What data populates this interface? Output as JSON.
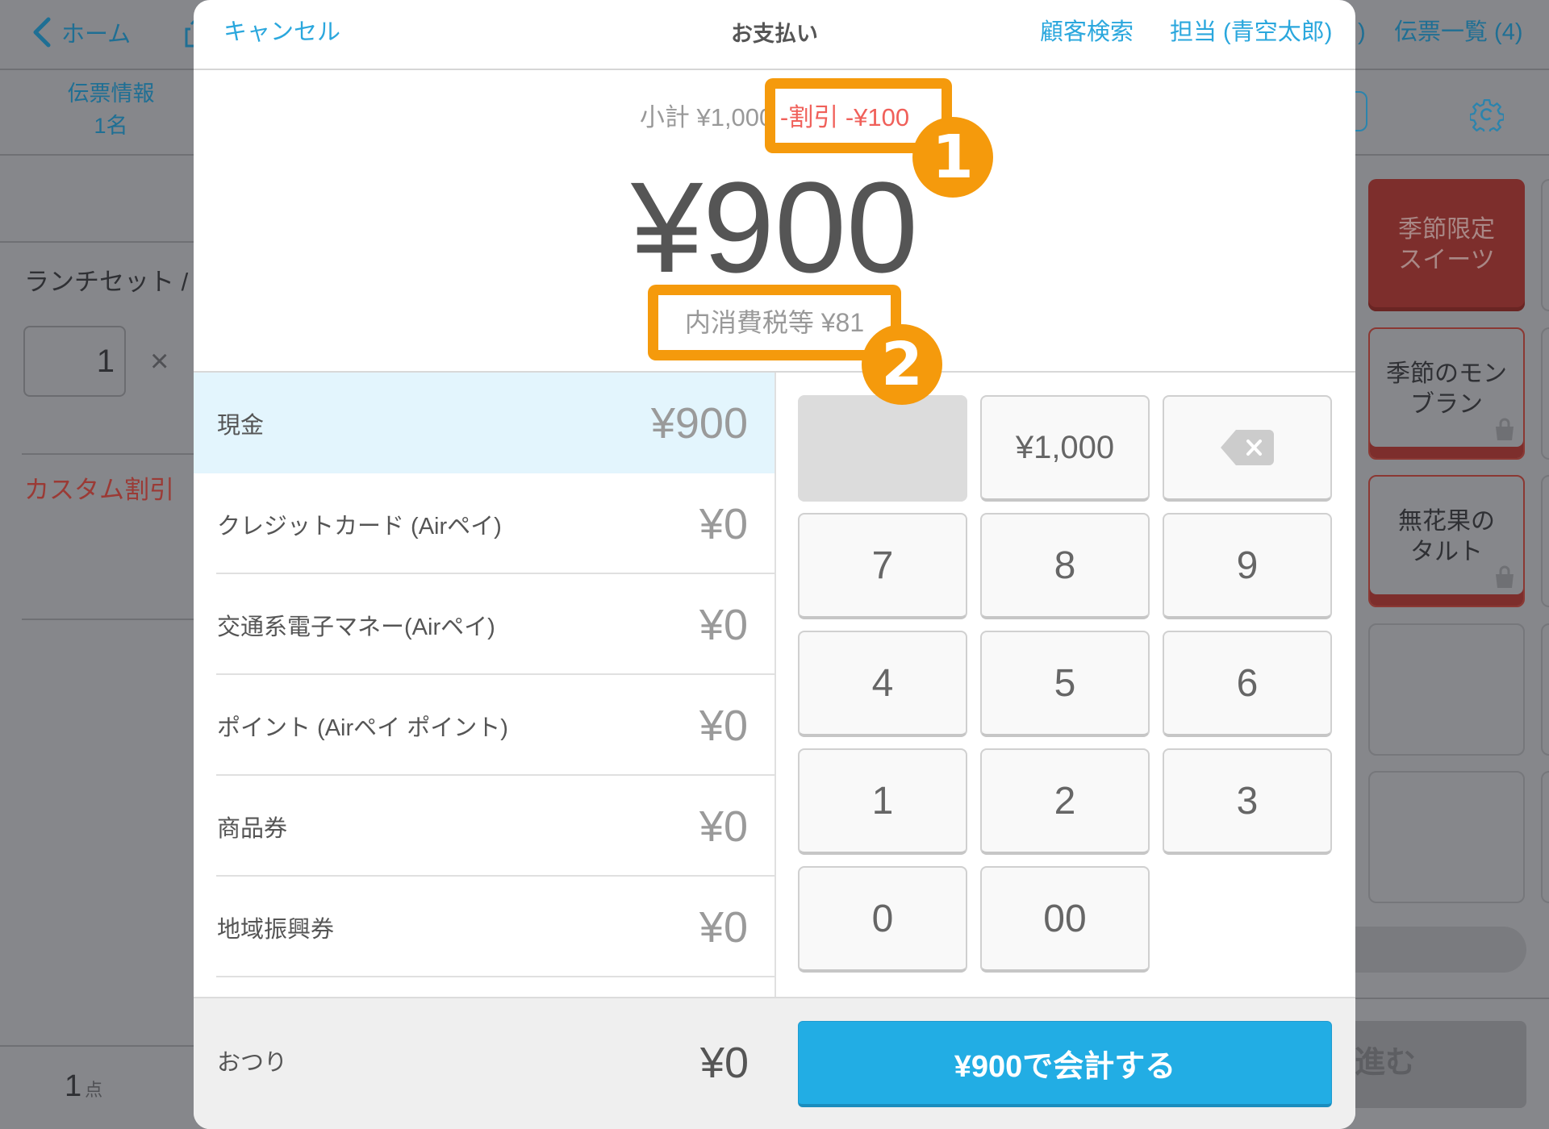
{
  "colors": {
    "accent": "#2aa7dd",
    "primary_button": "#22ade4",
    "discount_text": "#f0605a",
    "annotation": "#f59a0c",
    "selected_row": "#e3f5fd"
  },
  "icons": {
    "back": "chevron-left-icon",
    "share": "share-icon",
    "settings": "gear-icon",
    "bag": "shopping-bag-icon",
    "backspace": "backspace-icon"
  },
  "background": {
    "header": {
      "back_label": "ホーム",
      "partial_label": ")",
      "slip_list_label": "伝票一覧 (4)"
    },
    "slip_info": {
      "title": "伝票情報",
      "guests": "1名"
    },
    "order": {
      "item_name": "ランチセット /",
      "quantity": "1",
      "multiply": "×",
      "discount_label": "カスタム割引",
      "total_count": "1",
      "total_count_unit": "点"
    },
    "menu_tiles": [
      {
        "label": "季節限定\nスイーツ",
        "kind": "category"
      },
      {
        "label": "季節のモン\nブラン",
        "kind": "item"
      },
      {
        "label": "無花果の\nタルト",
        "kind": "item"
      }
    ],
    "proceed_label": "進む"
  },
  "modal": {
    "header": {
      "cancel": "キャンセル",
      "title": "お支払い",
      "customer_search": "顧客検索",
      "staff": "担当 (青空太郎)"
    },
    "summary": {
      "subtotal": "小計 ¥1,000",
      "discount": "-割引 -¥100",
      "total": "¥900",
      "tax": "内消費税等 ¥81"
    },
    "payment_methods": [
      {
        "label": "現金",
        "amount": "¥900",
        "selected": true
      },
      {
        "label": "クレジットカード (Airペイ)",
        "amount": "¥0",
        "selected": false
      },
      {
        "label": "交通系電子マネー(Airペイ)",
        "amount": "¥0",
        "selected": false
      },
      {
        "label": "ポイント (Airペイ ポイント)",
        "amount": "¥0",
        "selected": false
      },
      {
        "label": "商品券",
        "amount": "¥0",
        "selected": false
      },
      {
        "label": "地域振興券",
        "amount": "¥0",
        "selected": false
      }
    ],
    "keypad": [
      {
        "label": "",
        "disabled": true
      },
      {
        "label": "¥1,000"
      },
      {
        "label": "",
        "icon": "backspace-icon"
      },
      {
        "label": "7"
      },
      {
        "label": "8"
      },
      {
        "label": "9"
      },
      {
        "label": "4"
      },
      {
        "label": "5"
      },
      {
        "label": "6"
      },
      {
        "label": "1"
      },
      {
        "label": "2"
      },
      {
        "label": "3"
      },
      {
        "label": "0"
      },
      {
        "label": "00"
      }
    ],
    "footer": {
      "change_label": "おつり",
      "change_amount": "¥0",
      "checkout_label": "¥900で会計する"
    }
  },
  "annotations": [
    {
      "number": "1"
    },
    {
      "number": "2"
    }
  ]
}
